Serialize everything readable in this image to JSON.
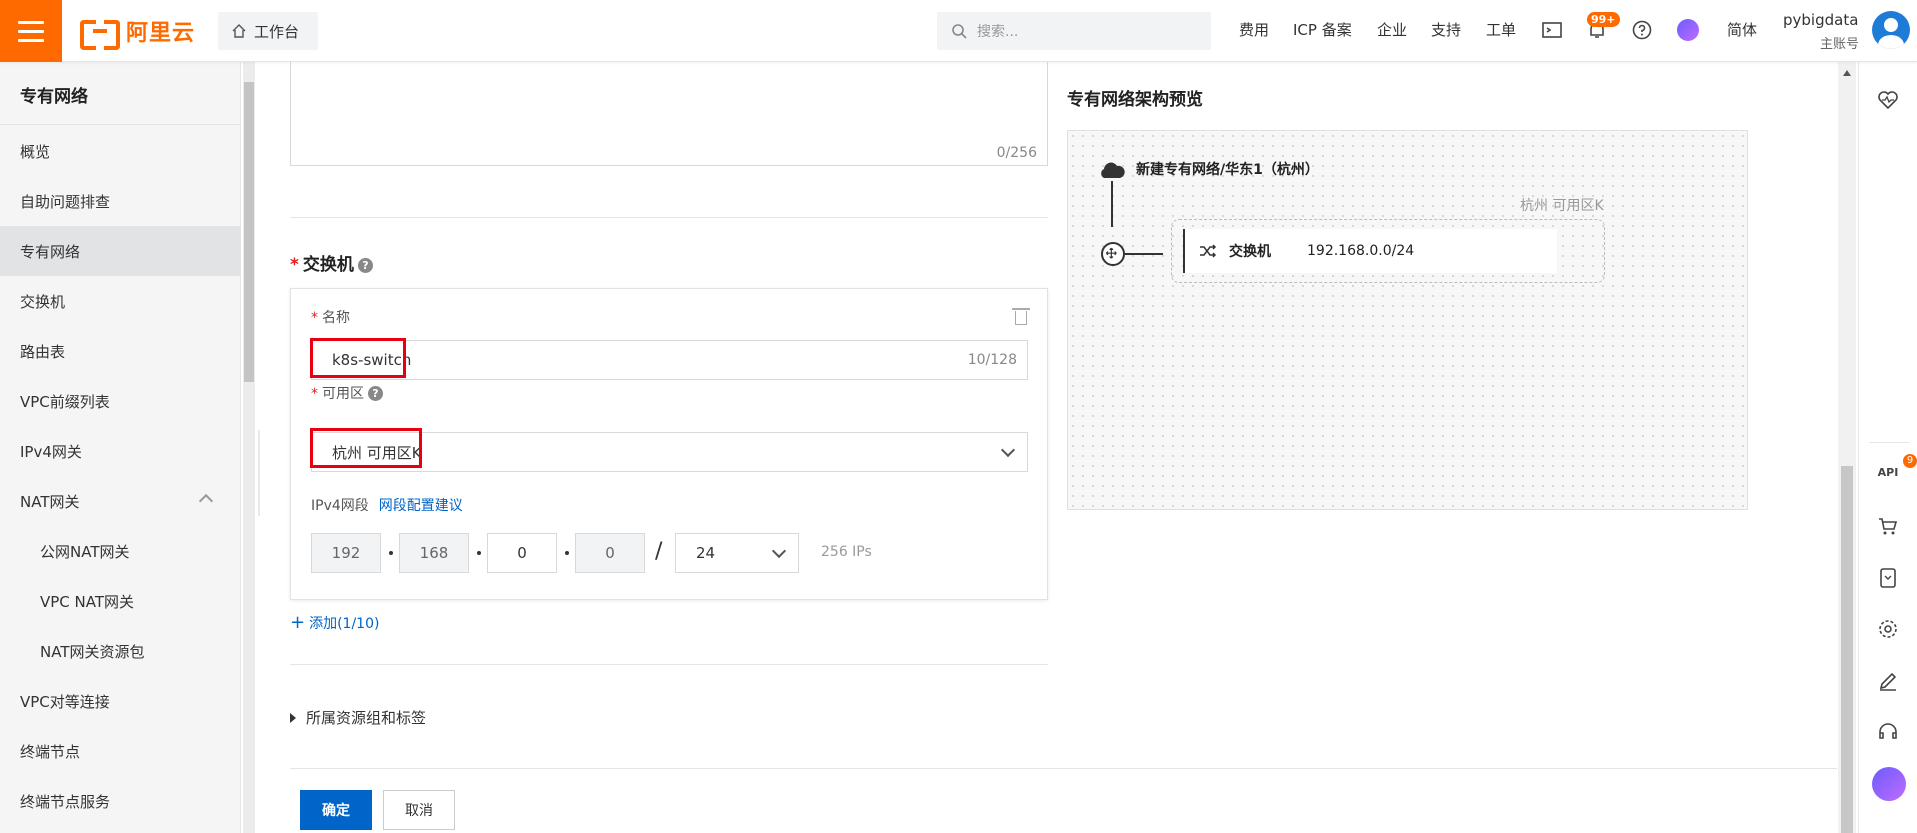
{
  "header": {
    "logo_text": "阿里云",
    "workbench": "工作台",
    "search_placeholder": "搜索...",
    "nav": [
      "费用",
      "ICP 备案",
      "企业",
      "支持",
      "工单"
    ],
    "notify_badge": "99+",
    "lang": "简体",
    "user_name": "pybigdata",
    "user_role": "主账号"
  },
  "sidebar": {
    "title": "专有网络",
    "items": [
      {
        "label": "概览"
      },
      {
        "label": "自助问题排查"
      },
      {
        "label": "专有网络",
        "active": true
      },
      {
        "label": "交换机"
      },
      {
        "label": "路由表"
      },
      {
        "label": "VPC前缀列表"
      },
      {
        "label": "IPv4网关"
      },
      {
        "label": "NAT网关"
      },
      {
        "label": "公网NAT网关",
        "sub": true
      },
      {
        "label": "VPC NAT网关",
        "sub": true
      },
      {
        "label": "NAT网关资源包",
        "sub": true
      },
      {
        "label": "VPC对等连接"
      },
      {
        "label": "终端节点"
      },
      {
        "label": "终端节点服务"
      }
    ]
  },
  "form": {
    "description_count": "0/256",
    "switch_section_title": "交换机",
    "name_label": "名称",
    "name_value": "k8s-switch",
    "name_count": "10/128",
    "zone_label": "可用区",
    "zone_value": "杭州 可用区K",
    "ipv4_label": "IPv4网段",
    "ipv4_link": "网段配置建议",
    "octets": [
      "192",
      "168",
      "0",
      "0"
    ],
    "mask": "24",
    "ip_count": "256 IPs",
    "add_label": "添加(1/10)",
    "resource_group_label": "所属资源组和标签",
    "ok_label": "确定",
    "cancel_label": "取消"
  },
  "preview": {
    "title": "专有网络架构预览",
    "vpc_name": "新建专有网络/华东1（杭州）",
    "zone": "杭州 可用区K",
    "switch_label": "交换机",
    "switch_cidr": "192.168.0.0/24"
  },
  "rail": {
    "api_badge": "9",
    "api_label": "API"
  },
  "colors": {
    "brand": "#ff6a00",
    "primary": "#0064c8",
    "highlight": "#e60012"
  }
}
